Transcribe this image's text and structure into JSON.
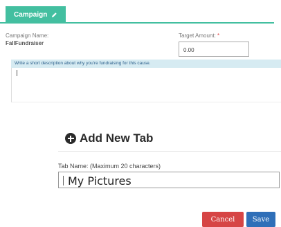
{
  "tab": {
    "label": "Campaign",
    "accent_color": "#43bfa0",
    "icon": "pencil-icon"
  },
  "campaign": {
    "name_label": "Campaign Name:",
    "name_value": "FallFundraiser",
    "target_label": "Target Amount:",
    "target_required_mark": "*",
    "target_value": "0.00"
  },
  "description": {
    "placeholder": "Write a short description about why you're fundraising for this cause.",
    "value": ""
  },
  "add_tab": {
    "icon": "plus-circle-icon",
    "heading": "Add New Tab",
    "name_label": "Tab Name: (Maximum 20 characters)",
    "name_value": "My Pictures"
  },
  "buttons": {
    "cancel_label": "Cancel",
    "cancel_color": "#d64545",
    "save_label": "Save",
    "save_color": "#2f6fb8"
  }
}
